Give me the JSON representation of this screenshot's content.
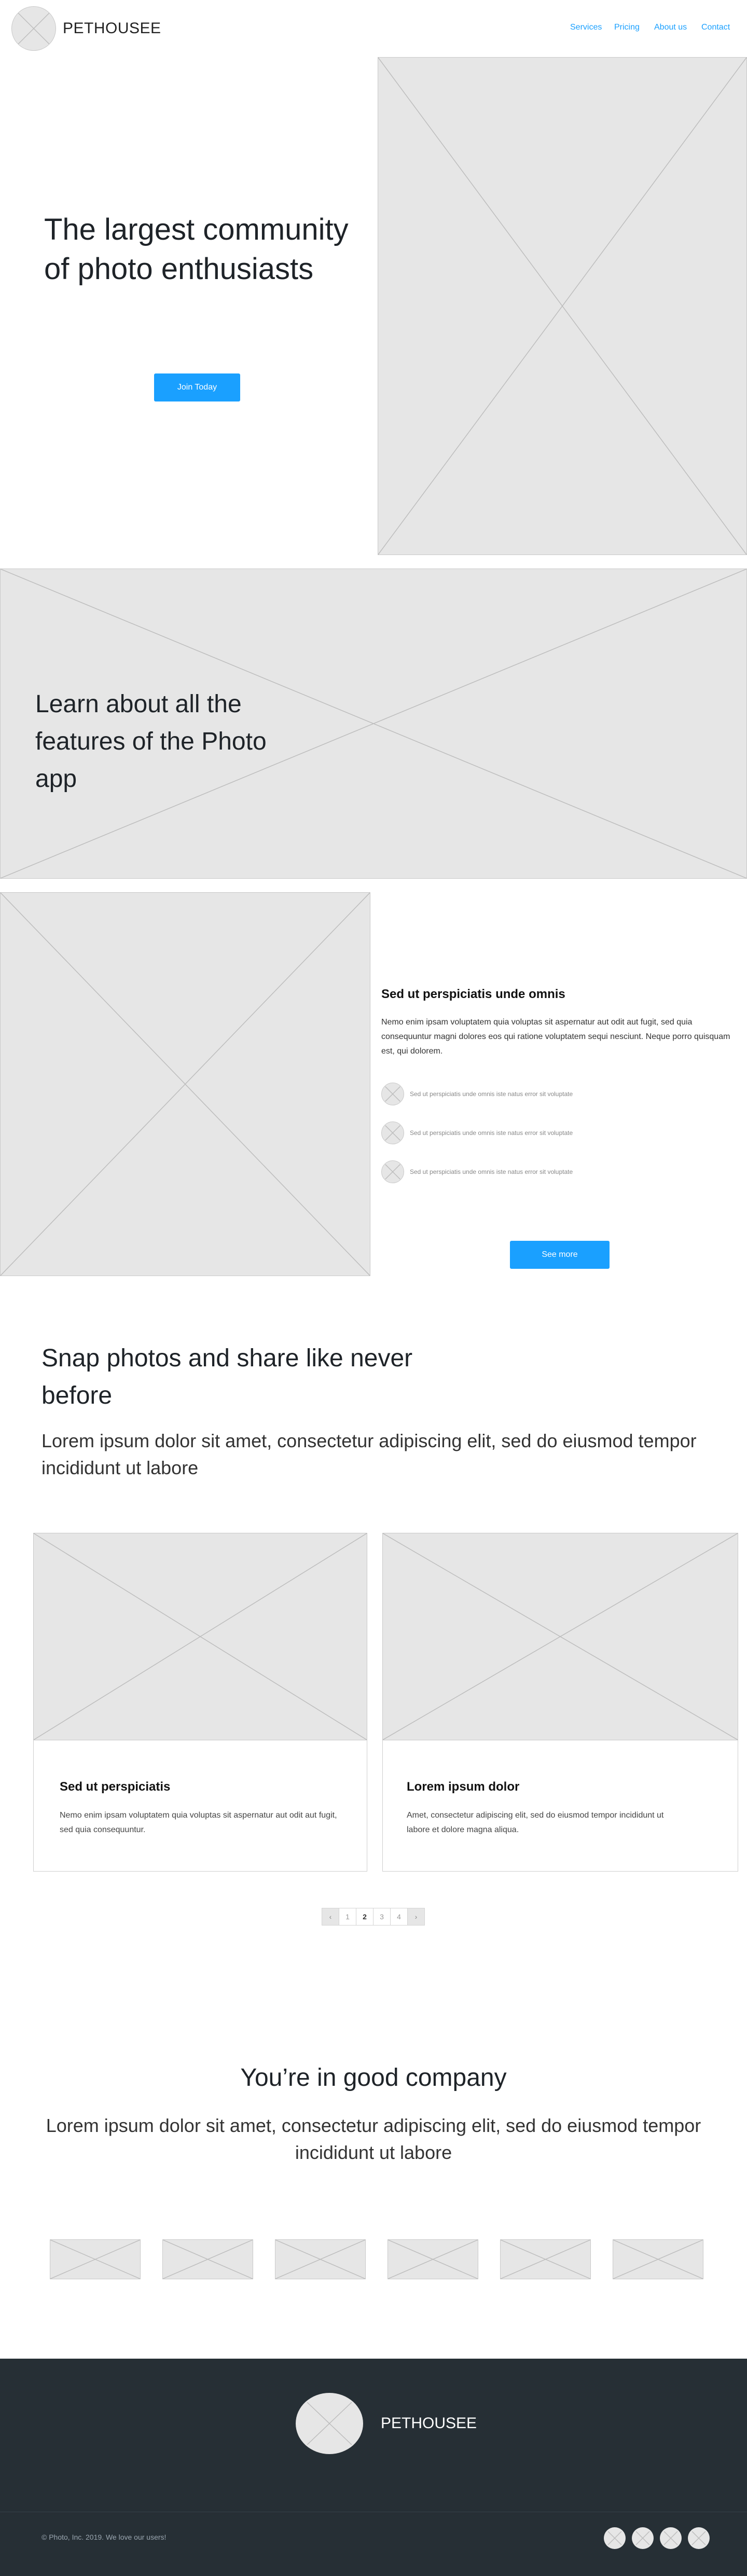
{
  "header": {
    "brand": "PETHOUSEE",
    "nav": [
      "Services",
      "Pricing",
      "About us",
      "Contact"
    ]
  },
  "hero": {
    "headline": "The largest community of photo enthusiasts",
    "cta": "Join Today"
  },
  "banner": {
    "headline": "Learn about all the features of the Photo app"
  },
  "features": {
    "title": "Sed ut perspiciatis unde omnis",
    "body": "Nemo enim ipsam voluptatem quia voluptas sit aspernatur aut odit aut fugit, sed quia consequuntur magni dolores eos qui ratione voluptatem sequi nesciunt. Neque porro quisquam est, qui dolorem.",
    "items": [
      "Sed ut perspiciatis unde omnis iste natus error sit voluptate",
      "Sed ut perspiciatis unde omnis iste natus error sit voluptate",
      "Sed ut perspiciatis unde omnis iste natus error sit voluptate"
    ],
    "cta": "See more"
  },
  "snap": {
    "headline": "Snap photos and share like never before",
    "subhead": "Lorem ipsum dolor sit amet, consectetur adipiscing elit, sed do eiusmod tempor incididunt ut labore"
  },
  "cards": [
    {
      "title": "Sed ut perspiciatis",
      "body": "Nemo enim ipsam voluptatem quia voluptas sit aspernatur aut odit aut fugit, sed quia consequuntur."
    },
    {
      "title": "Lorem ipsum dolor",
      "body": "Amet, consectetur adipiscing elit, sed do eiusmod tempor incididunt ut labore et dolore magna aliqua."
    }
  ],
  "pagination": {
    "prev": "‹",
    "pages": [
      "1",
      "2",
      "3",
      "4"
    ],
    "current": "2",
    "next": "›"
  },
  "company": {
    "headline": "You’re in good company",
    "subhead": "Lorem ipsum dolor sit amet, consectetur adipiscing elit, sed do eiusmod tempor incididunt ut labore"
  },
  "footer": {
    "brand": "PETHOUSEE",
    "copyright": "© Photo, Inc. 2019. We love our users!"
  },
  "colors": {
    "accent": "#1aa0ff",
    "footer_bg": "#262f35",
    "placeholder": "#e6e6e6"
  }
}
